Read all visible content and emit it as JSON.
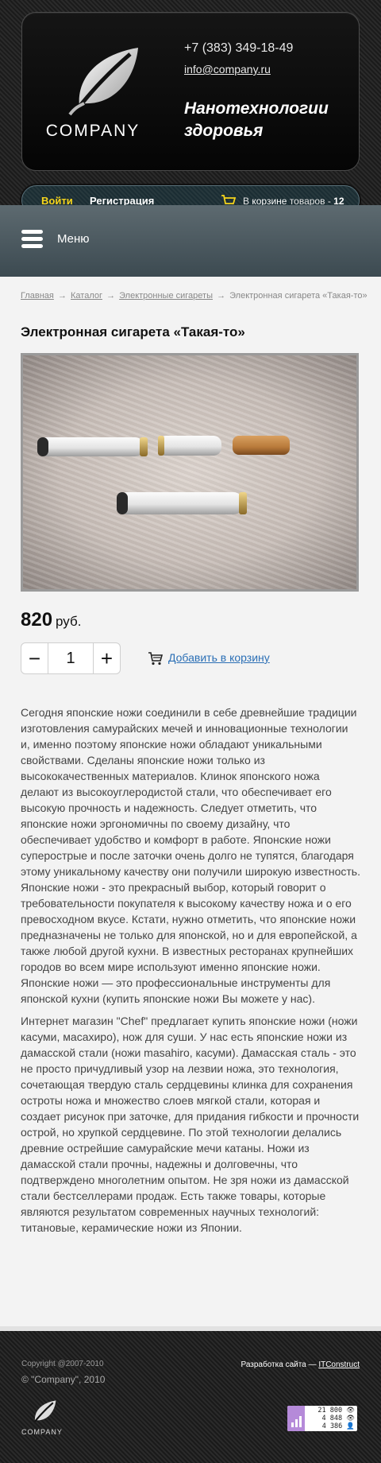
{
  "header": {
    "logo_text": "COMPANY",
    "phone": "+7 (383) 349-18-49",
    "email": "info@company.ru",
    "slogan_line1": "Нанотехнологии",
    "slogan_line2": "здоровья"
  },
  "userbar": {
    "login": "Войти",
    "register": "Регистрация",
    "cart_prefix": "В",
    "cart_link": "корзине",
    "cart_suffix": "товаров -",
    "cart_count": "12",
    "accent": "#f7d51b"
  },
  "menu": {
    "label": "Меню"
  },
  "breadcrumb": {
    "items": [
      "Главная",
      "Каталог",
      "Электронные сигареты"
    ],
    "current": "Электронная сигарета «Такая-то»",
    "separator": "→"
  },
  "product": {
    "title": "Электронная сигарета «Такая-то»",
    "price": "820",
    "currency": "руб.",
    "quantity": "1",
    "minus": "−",
    "plus": "+",
    "add_to_cart": "Добавить в корзину",
    "link_color": "#2b6fb5"
  },
  "description": {
    "paragraph1": "Сегодня японские ножи соединили в себе древнейшие традиции изготовления самурайских мечей и инновационные технологии и, именно поэтому японские ножи обладают уникальными свойствами. Сделаны японские ножи только из высококачественных материалов. Клинок японского ножа делают из высокоуглеродистой стали, что обеспечивает его высокую прочность и надежность. Следует отметить, что японские ножи эргономичны по своему дизайну, что обеспечивает удобство и комфорт в работе. Японские ножи суперострые и после заточки очень долго не тупятся, благодаря этому уникальному качеству они получили широкую известность. Японские ножи - это прекрасный выбор, который говорит о требовательности покупателя к высокому качеству ножа и о его превосходном вкусе. Кстати, нужно отметить, что японские ножи предназначены не только для японской, но и для европейской, а также любой другой кухни. В известных ресторанах крупнейших городов во всем мире используют именно японские ножи. Японские ножи — это профессиональные инструменты для японской кухни (купить японские ножи Вы можете у нас).",
    "paragraph2": "Интернет магазин \"Chef\" предлагает купить японские ножи (ножи касуми, масахиро), нож для суши. У нас есть японские ножи из дамасской стали (ножи masahiro, касуми). Дамасская сталь - это не просто причудливый узор на лезвии ножа, это технология, сочетающая твердую сталь сердцевины клинка для сохранения остроты ножа и множество слоев мягкой стали, которая и создает рисунок при заточке, для придания гибкости и прочности острой, но хрупкой сердцевине. По этой технологии делались древние острейшие самурайские мечи катаны. Ножи из дамасской стали прочны, надежны и долговечны, что подтверждено многолетним опытом. Не зря ножи из дамасской стали бестселлерами продаж. Есть также товары, которые являются результатом современных научных технологий: титановые, керамические ножи из Японии."
  },
  "footer": {
    "copyright": "Copyright @2007-2010",
    "company": "© \"Company\", 2010",
    "dev_prefix": "Разработка сайта —",
    "dev_link": "ITConstruct",
    "logo_text": "COMPANY",
    "counter": [
      "21 800 👁",
      "4 848 👁",
      "4 386 👤"
    ]
  }
}
